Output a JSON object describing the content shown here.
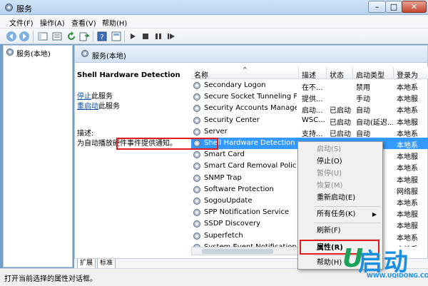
{
  "window": {
    "title": "服务",
    "min_label": "–",
    "max_label": "□",
    "close_label": "✕"
  },
  "menu": [
    "文件(F)",
    "操作(A)",
    "查看(V)",
    "帮助(H)"
  ],
  "tree": {
    "root": "服务(本地)"
  },
  "panel": {
    "header": "服务(本地)",
    "service_name": "Shell Hardware Detection",
    "stop_link": "停止",
    "stop_suffix": "此服务",
    "restart_link": "重启动",
    "restart_suffix": "此服务",
    "desc_label": "描述:",
    "desc_text": "为自动播放硬件事件提供通知。"
  },
  "columns": {
    "name": "名称",
    "desc": "描述",
    "status": "状态",
    "startup": "启动类型",
    "logon": "登录为"
  },
  "rows": [
    {
      "name": "Secondary Logon",
      "desc": "在不...",
      "status": "",
      "startup": "禁用",
      "logon": "本地系"
    },
    {
      "name": "Secure Socket Tunneling Pr...",
      "desc": "提供...",
      "status": "",
      "startup": "手动",
      "logon": "本地服"
    },
    {
      "name": "Security Accounts Manager",
      "desc": "启动...",
      "status": "已启动",
      "startup": "自动",
      "logon": "本地系"
    },
    {
      "name": "Security Center",
      "desc": "WSC...",
      "status": "已启动",
      "startup": "自动(延迟...",
      "logon": "本地服"
    },
    {
      "name": "Server",
      "desc": "支持...",
      "status": "已启动",
      "startup": "自动",
      "logon": "本地系"
    },
    {
      "name": "Shell Hardware Detection",
      "desc": "",
      "status": "",
      "startup": "",
      "logon": "本地系"
    },
    {
      "name": "Smart Card",
      "desc": "",
      "status": "",
      "startup": "",
      "logon": "本地服"
    },
    {
      "name": "Smart Card Removal Policy",
      "desc": "",
      "status": "",
      "startup": "",
      "logon": "本地系"
    },
    {
      "name": "SNMP Trap",
      "desc": "",
      "status": "",
      "startup": "",
      "logon": "本地服"
    },
    {
      "name": "Software Protection",
      "desc": "",
      "status": "",
      "startup": "",
      "logon": "网络服"
    },
    {
      "name": "SogouUpdate",
      "desc": "",
      "status": "",
      "startup": "",
      "logon": "本地系"
    },
    {
      "name": "SPP Notification Service",
      "desc": "",
      "status": "",
      "startup": "",
      "logon": "本地服"
    },
    {
      "name": "SSDP Discovery",
      "desc": "",
      "status": "",
      "startup": "",
      "logon": "本地服"
    },
    {
      "name": "Superfetch",
      "desc": "",
      "status": "",
      "startup": "",
      "logon": "本地系"
    },
    {
      "name": "System Event Notification S...",
      "desc": "",
      "status": "",
      "startup": "",
      "logon": "本地系"
    }
  ],
  "context_menu": {
    "start": "启动(S)",
    "stop": "停止(O)",
    "pause": "暂停(U)",
    "resume": "恢复(M)",
    "restart": "重新启动(E)",
    "all_tasks": "所有任务(K)",
    "all_tasks_arrow": "▶",
    "refresh": "刷新(F)",
    "properties": "属性(R)",
    "help": "帮助(H)"
  },
  "tabs": [
    "扩展",
    "标准"
  ],
  "status_text": "打开当前选择的属性对话框。",
  "watermark": {
    "big": "启动",
    "small": "WWW.UQIDONG.COM",
    "logo": "U"
  },
  "colors": {
    "selection": "#3399ff",
    "highlight_box": "#e11a1a",
    "link": "#0b4ea2"
  }
}
